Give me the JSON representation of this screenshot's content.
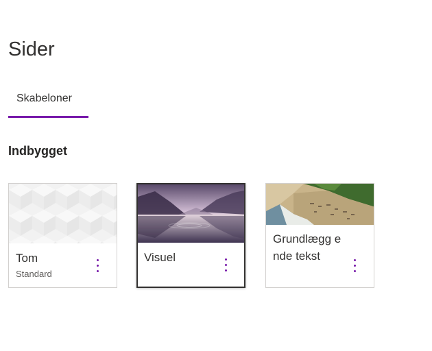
{
  "page": {
    "title": "Sider"
  },
  "tabs": [
    {
      "label": "Skabeloner",
      "selected": true
    }
  ],
  "section": {
    "heading": "Indbygget"
  },
  "templates": [
    {
      "title": "Tom",
      "subtitle": "Standard",
      "thumbnail": "white-cube-pattern",
      "more_icon": "more-vertical-icon"
    },
    {
      "title": "Visuel",
      "subtitle": "",
      "thumbnail": "misty-lake-landscape",
      "more_icon": "more-vertical-icon",
      "selected": true
    },
    {
      "title": "Grundlægg ende tekst",
      "subtitle": "",
      "thumbnail": "aerial-coastline",
      "more_icon": "more-vertical-icon"
    }
  ],
  "colors": {
    "accent": "#7719aa",
    "text": "#323130",
    "border": "#d2d0ce"
  }
}
